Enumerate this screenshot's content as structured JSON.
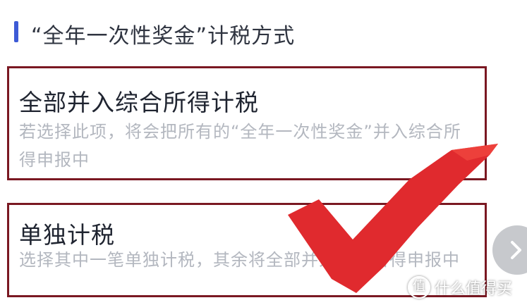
{
  "header": {
    "title": "“全年一次性奖金”计税方式"
  },
  "options": [
    {
      "title": "全部并入综合所得计税",
      "description": "若选择此项，将会把所有的“全年一次性奖金”并入综合所得申报中",
      "selected": true
    },
    {
      "title": "单独计税",
      "description": "选择其中一笔单独计税，其余将全部并入综合所得申报中",
      "selected": false
    }
  ],
  "watermark": {
    "badge": "值",
    "text": "什么值得买"
  },
  "icons": {
    "next": "chevron-right-icon",
    "checkmark": "checkmark-icon"
  },
  "colors": {
    "accent_bar": "#3d5bd6",
    "option_border": "#7a1822",
    "checkmark": "#e02a2e"
  }
}
